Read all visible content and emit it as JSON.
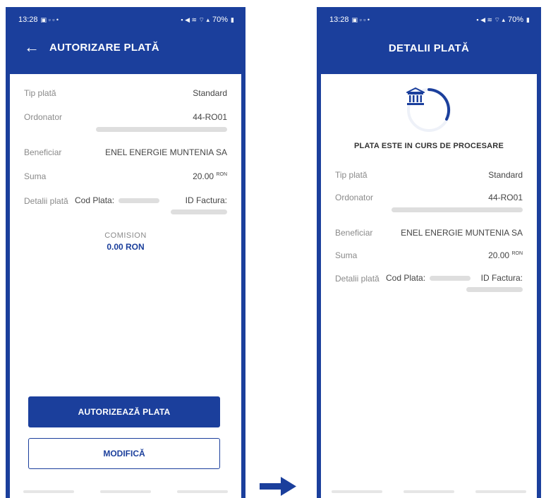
{
  "left": {
    "status": {
      "time": "13:28",
      "battery": "70%"
    },
    "title": "AUTORIZARE PLATĂ",
    "rows": [
      {
        "label": "Tip plată",
        "value": "Standard"
      },
      {
        "label": "Ordonator",
        "value": "44-RO01"
      },
      {
        "label": "Beneficiar",
        "value": "ENEL ENERGIE MUNTENIA SA"
      },
      {
        "label": "Suma",
        "value": "20.00",
        "unit": "RON"
      }
    ],
    "details": {
      "label": "Detalii plată",
      "cod_label": "Cod Plata:",
      "id_label": "ID Factura:"
    },
    "commission": {
      "label": "COMISION",
      "value": "0.00 RON"
    },
    "authorize_label": "AUTORIZEAZĂ PLATA",
    "modify_label": "MODIFICĂ"
  },
  "right": {
    "status": {
      "time": "13:28",
      "battery": "70%"
    },
    "title": "DETALII PLATĂ",
    "processing_text": "PLATA ESTE IN CURS DE PROCESARE",
    "rows": [
      {
        "label": "Tip plată",
        "value": "Standard"
      },
      {
        "label": "Ordonator",
        "value": "44-RO01"
      },
      {
        "label": "Beneficiar",
        "value": "ENEL ENERGIE MUNTENIA SA"
      },
      {
        "label": "Suma",
        "value": "20.00",
        "unit": "RON"
      }
    ],
    "details": {
      "label": "Detalii plată",
      "cod_label": "Cod Plata:",
      "id_label": "ID Factura:"
    }
  },
  "icons": {
    "back": "arrow-left-icon",
    "bank": "bank-icon",
    "transition": "arrow-right-icon"
  },
  "colors": {
    "brand": "#1b3f9c",
    "label": "#8a8a8a",
    "value": "#444444",
    "redacted": "#dedede"
  }
}
